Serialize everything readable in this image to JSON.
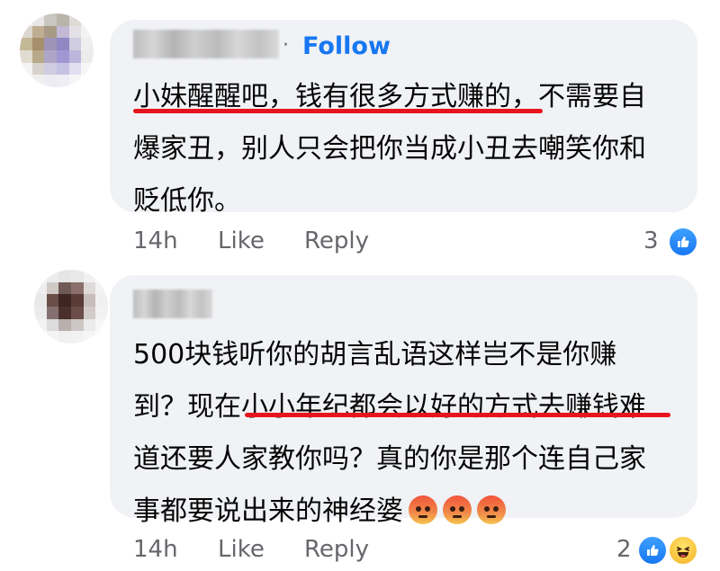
{
  "comments": [
    {
      "follow_separator": "·",
      "follow_label": "Follow",
      "text_lines": [
        "小妹醒醒吧，钱有很多方式赚的，不需要自",
        "爆家丑，别人只会把你当成小丑去嘲笑你和",
        "贬低你。"
      ],
      "time": "14h",
      "like_label": "Like",
      "reply_label": "Reply",
      "reaction_count": "3",
      "reaction_icons": [
        "like-icon"
      ],
      "avatar_colors": [
        "#efefef",
        "#e8e6e6",
        "#c9c6c0",
        "#b9b4aa",
        "#dedad6",
        "#f2f2f2",
        "#dcd8d0",
        "#bfae92",
        "#a89b86",
        "#c3b9d4",
        "#e3e1e6",
        "#f3f3f3",
        "#c4b896",
        "#a68f6a",
        "#9e93b8",
        "#8f88c2",
        "#cfcce0",
        "#efefef",
        "#e1dcd0",
        "#b7a98a",
        "#aea6c8",
        "#9f98d2",
        "#bdb6dc",
        "#ececec",
        "#f3f3f3",
        "#d7d3cc",
        "#cfcbe0",
        "#c6c2e2",
        "#e1dff0",
        "#f6f6f6",
        "#f7f7f7",
        "#efefef",
        "#ececf2",
        "#eeeef4",
        "#f5f5f8",
        "#fafafa"
      ]
    },
    {
      "text_lines": [
        "500块钱听你的胡言乱语这样岂不是你赚",
        "到？现在小小年纪都会以好的方式去赚钱难",
        "道还要人家教你吗？真的你是那个连自己家",
        "事都要说出来的神经婆"
      ],
      "trailing_emoji": [
        "angry-face-icon",
        "angry-face-icon",
        "angry-face-icon"
      ],
      "time": "14h",
      "like_label": "Like",
      "reply_label": "Reply",
      "reaction_count": "2",
      "reaction_icons": [
        "like-icon",
        "haha-icon"
      ],
      "avatar_colors": [
        "#f4f4f4",
        "#ececec",
        "#e6e6e6",
        "#e9e9e9",
        "#f1f1f1",
        "#f8f8f8",
        "#eeeeee",
        "#cfcac6",
        "#6f5a56",
        "#8b6f6a",
        "#dedada",
        "#f3f3f3",
        "#e8e8e8",
        "#6a4e48",
        "#3f2622",
        "#5a3b35",
        "#c7bebb",
        "#f0f0f0",
        "#ebebeb",
        "#857070",
        "#4a2f2b",
        "#6a4d48",
        "#d2cbc9",
        "#f2f2f2",
        "#f3f3f3",
        "#dcdcdc",
        "#b9b0ae",
        "#cdc6c4",
        "#ebebeb",
        "#f7f7f7",
        "#f9f9f9",
        "#f4f4f4",
        "#f0f0f0",
        "#f2f2f2",
        "#f6f6f6",
        "#fbfbfb"
      ]
    }
  ],
  "colors": {
    "bubble": "#f0f2f5",
    "follow": "#1877f2",
    "meta": "#65676b",
    "highlight_underline": "#e8141c"
  }
}
